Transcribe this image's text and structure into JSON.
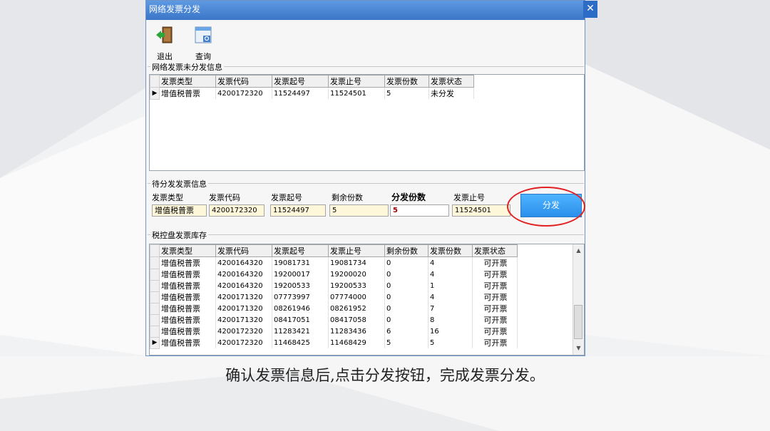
{
  "window": {
    "title": "网络发票分发",
    "close_glyph": "✕"
  },
  "toolbar": {
    "exit_label": "退出",
    "query_label": "查询"
  },
  "undistributed": {
    "group_title": "网络发票未分发信息",
    "columns": [
      "发票类型",
      "发票代码",
      "发票起号",
      "发票止号",
      "发票份数",
      "发票状态"
    ],
    "rows": [
      {
        "selected": true,
        "cells": [
          "增值税普票",
          "4200172320",
          "11524497",
          "11524501",
          "5",
          "未分发"
        ]
      }
    ]
  },
  "pending": {
    "group_title": "待分发发票信息",
    "labels": {
      "type": "发票类型",
      "code": "发票代码",
      "start": "发票起号",
      "remaining": "剩余份数",
      "count": "分发份数",
      "end": "发票止号"
    },
    "values": {
      "type": "增值税普票",
      "code": "4200172320",
      "start": "11524497",
      "remaining": "5",
      "count": "5",
      "end": "11524501"
    },
    "distribute_label": "分发"
  },
  "inventory": {
    "group_title": "税控盘发票库存",
    "columns": [
      "发票类型",
      "发票代码",
      "发票起号",
      "发票止号",
      "剩余份数",
      "发票份数",
      "发票状态"
    ],
    "rows": [
      {
        "selected": false,
        "cells": [
          "增值税普票",
          "4200164320",
          "19081731",
          "19081734",
          "0",
          "4",
          "可开票"
        ]
      },
      {
        "selected": false,
        "cells": [
          "增值税普票",
          "4200164320",
          "19200017",
          "19200020",
          "0",
          "4",
          "可开票"
        ]
      },
      {
        "selected": false,
        "cells": [
          "增值税普票",
          "4200164320",
          "19200533",
          "19200533",
          "0",
          "1",
          "可开票"
        ]
      },
      {
        "selected": false,
        "cells": [
          "增值税普票",
          "4200171320",
          "07773997",
          "07774000",
          "0",
          "4",
          "可开票"
        ]
      },
      {
        "selected": false,
        "cells": [
          "增值税普票",
          "4200171320",
          "08261946",
          "08261952",
          "0",
          "7",
          "可开票"
        ]
      },
      {
        "selected": false,
        "cells": [
          "增值税普票",
          "4200171320",
          "08417051",
          "08417058",
          "0",
          "8",
          "可开票"
        ]
      },
      {
        "selected": false,
        "cells": [
          "增值税普票",
          "4200172320",
          "11283421",
          "11283436",
          "6",
          "16",
          "可开票"
        ]
      },
      {
        "selected": true,
        "cells": [
          "增值税普票",
          "4200172320",
          "11468425",
          "11468429",
          "5",
          "5",
          "可开票"
        ]
      }
    ]
  },
  "caption": "确认发票信息后,点击分发按钮，完成发票分发。",
  "colors": {
    "title_bar": "#3b76c8",
    "button": "#2a8fea",
    "annotation": "#e32020"
  }
}
